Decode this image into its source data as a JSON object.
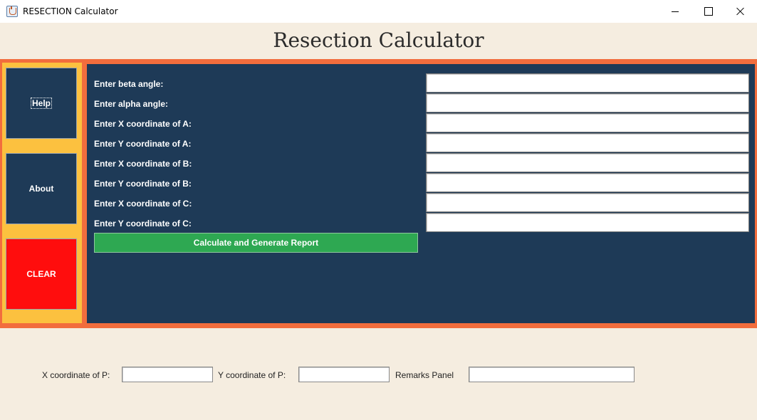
{
  "window": {
    "title": "RESECTION Calculator"
  },
  "header": {
    "title": "Resection Calculator"
  },
  "sidebar": {
    "help_label": "Help",
    "about_label": "About",
    "clear_label": "CLEAR"
  },
  "form": {
    "fields": [
      {
        "label": "Enter beta angle:",
        "value": ""
      },
      {
        "label": "Enter alpha angle:",
        "value": ""
      },
      {
        "label": "Enter X coordinate of A:",
        "value": ""
      },
      {
        "label": "Enter Y coordinate of A:",
        "value": ""
      },
      {
        "label": "Enter X coordinate of B:",
        "value": ""
      },
      {
        "label": "Enter Y coordinate of B:",
        "value": ""
      },
      {
        "label": "Enter X coordinate of C:",
        "value": ""
      },
      {
        "label": "Enter Y coordinate of C:",
        "value": ""
      }
    ],
    "submit_label": "Calculate and Generate Report"
  },
  "results": {
    "x_label": "X coordinate of P:",
    "x_value": "",
    "y_label": "Y coordinate of P:",
    "y_value": "",
    "remarks_label": "Remarks Panel",
    "remarks_value": ""
  },
  "colors": {
    "main_panel": "#1e3a57",
    "sidebar": "#fcc13f",
    "border_accent": "#f26d3d",
    "calculate_button": "#2ea852",
    "clear_button": "#ff0d0d",
    "background": "#f5ede0"
  },
  "icons": {
    "app": "java-cup-icon",
    "minimize": "minimize-icon",
    "maximize": "maximize-icon",
    "close": "close-icon"
  }
}
